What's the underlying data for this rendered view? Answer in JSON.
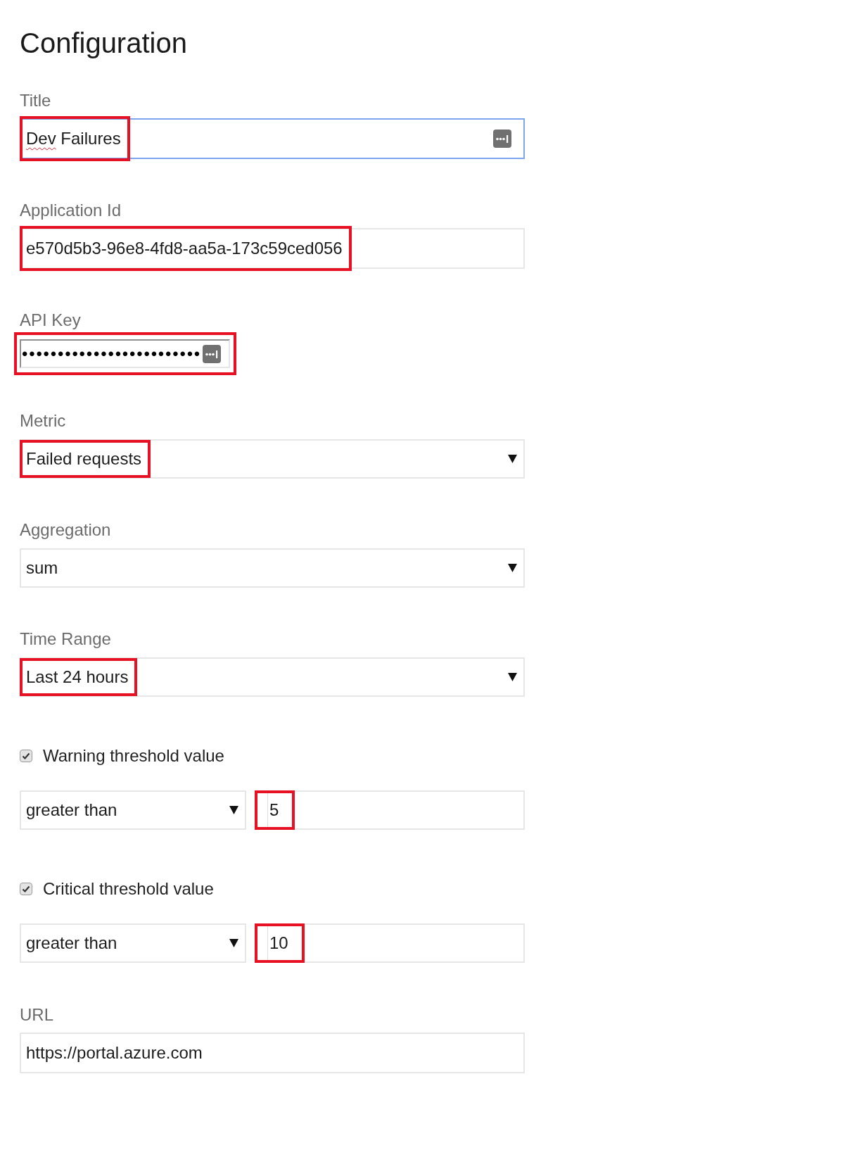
{
  "heading": "Configuration",
  "fields": [
    {
      "kind": "text",
      "label": "Title",
      "value": [
        {
          "text": "Dev",
          "misspelled": true
        },
        {
          "text": "Failures",
          "misspelled": false
        }
      ],
      "focused": true,
      "highlighted": true,
      "autofill_icon": true
    },
    {
      "kind": "text",
      "label": "Application Id",
      "value": "e570d5b3-96e8-4fd8-aa5a-173c59ced056",
      "focused": false,
      "highlighted": true,
      "autofill_icon": false
    },
    {
      "kind": "password",
      "label": "API Key",
      "value": "•••••••••••••••••••••••••",
      "highlighted": true,
      "autofill_icon": true
    },
    {
      "kind": "select",
      "label": "Metric",
      "value": "Failed requests",
      "highlighted": true
    },
    {
      "kind": "select",
      "label": "Aggregation",
      "value": "sum",
      "highlighted": false
    },
    {
      "kind": "select",
      "label": "Time Range",
      "value": "Last 24 hours",
      "highlighted": true
    },
    {
      "kind": "threshold",
      "label": "Warning threshold value",
      "checked": true,
      "operator": {
        "value": "greater than",
        "highlighted": false
      },
      "value": "5",
      "highlighted": true
    },
    {
      "kind": "threshold",
      "label": "Critical threshold value",
      "checked": true,
      "operator": {
        "value": "greater than",
        "highlighted": false
      },
      "value": "10",
      "highlighted": true
    },
    {
      "kind": "text",
      "label": "URL",
      "value": "https://portal.azure.com",
      "focused": false,
      "highlighted": false,
      "autofill_icon": false
    }
  ]
}
